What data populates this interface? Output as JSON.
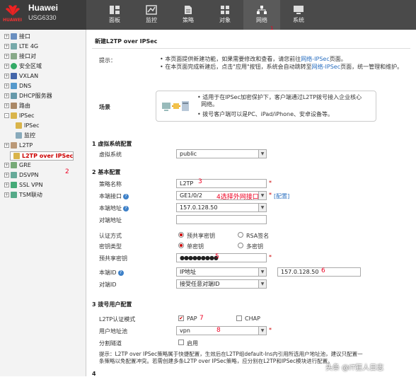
{
  "app": {
    "brand": "HUAWEI",
    "title": "Huawei",
    "model": "USG6330"
  },
  "nav": [
    {
      "label": "面板",
      "icon": "dashboard-icon"
    },
    {
      "label": "监控",
      "icon": "monitor-icon"
    },
    {
      "label": "策略",
      "icon": "policy-icon"
    },
    {
      "label": "对象",
      "icon": "object-icon"
    },
    {
      "label": "网络",
      "icon": "network-icon"
    },
    {
      "label": "系统",
      "icon": "system-icon"
    }
  ],
  "sidebar": {
    "items": [
      {
        "label": "接口",
        "icon": "interface-icon"
      },
      {
        "label": "LTE 4G",
        "icon": "lte-icon"
      },
      {
        "label": "接口对",
        "icon": "interface-pair-icon"
      },
      {
        "label": "安全区域",
        "icon": "security-zone-icon"
      },
      {
        "label": "VXLAN",
        "icon": "vxlan-icon"
      },
      {
        "label": "DNS",
        "icon": "dns-icon"
      },
      {
        "label": "DHCP服务器",
        "icon": "dhcp-icon"
      },
      {
        "label": "路由",
        "icon": "route-icon"
      },
      {
        "label": "IPSec",
        "icon": "ipsec-icon"
      },
      {
        "label": "IPSec",
        "icon": "ipsec-sub-icon"
      },
      {
        "label": "监控",
        "icon": "ipsec-monitor-icon"
      },
      {
        "label": "L2TP",
        "icon": "l2tp-icon"
      },
      {
        "label": "L2TP over IPSec",
        "icon": "l2tp-ipsec-icon"
      },
      {
        "label": "GRE",
        "icon": "gre-icon"
      },
      {
        "label": "DSVPN",
        "icon": "dsvpn-icon"
      },
      {
        "label": "SSL VPN",
        "icon": "sslvpn-icon"
      },
      {
        "label": "TSM联动",
        "icon": "tsm-icon"
      }
    ]
  },
  "annotations": {
    "a1": "1",
    "a2": "2",
    "a3": "3",
    "a4": "4选择外网接口",
    "a5": "5",
    "a6": "6",
    "a7": "7",
    "a8": "8"
  },
  "page": {
    "title": "新建L2TP over IPSec",
    "tip_label": "提示：",
    "tip_line1_pre": "本页面提供新建功能，如果需要修改和查看，请您前往",
    "tip_link1": "网络-IPSec",
    "tip_line1_post": "页面。",
    "tip_line2_pre": "在本页面完成新建后，点击\"应用\"按钮，系统会自动跳转至",
    "tip_link2": "网络-IPSec",
    "tip_line2_post": "页面，统一管理和维护。",
    "scene_label": "场景",
    "scene_line1": "适用于在IPSec加密保护下，客户端通过L2TP拨号接入企业核心",
    "scene_line1b": "网络。",
    "scene_line2": "拨号客户端可以是PC、iPad/iPhone、安卓设备等。",
    "sec1": "1 虚拟系统配置",
    "vsys_label": "虚拟系统",
    "vsys_value": "public",
    "sec2": "2 基本配置",
    "policy_name_label": "策略名称",
    "policy_name_value": "L2TP",
    "local_if_label": "本端接口",
    "local_if_value": "GE1/0/2",
    "config_link": "[配置]",
    "local_addr_label": "本端地址",
    "local_addr_value": "157.0.128.50",
    "peer_addr_label": "对端地址",
    "peer_addr_value": "",
    "auth_label": "认证方式",
    "auth_opt1": "预共享密钥",
    "auth_opt2": "RSA签名",
    "key_type_label": "密钥类型",
    "key_opt1": "单密钥",
    "key_opt2": "多密钥",
    "psk_label": "预共享密钥",
    "psk_value": "●●●●●●●●●",
    "local_id_label": "本端ID",
    "local_id_value": "IP地址",
    "local_id_ip": "157.0.128.50",
    "peer_id_label": "对端ID",
    "peer_id_value": "接受任意对端ID",
    "sec3": "3 拨号用户配置",
    "l2tp_auth_label": "L2TP认证模式",
    "pap": "PAP",
    "chap": "CHAP",
    "pool_label": "用户地址池",
    "pool_value": "vpn",
    "split_label": "分割隧道",
    "split_opt": "启用",
    "bottom_tip_line1": "提示：L2TP over IPSec策略属于快捷配置，生效后在L2TP组default-lns内引用所选用户地址池，建议只配置一",
    "bottom_tip_line2": "条策略以免配置冲突。若需创建多条L2TP over IPSec策略，应分别在L2TP和IPSec模块进行配置。",
    "star": "*",
    "sec4": "4"
  },
  "watermark": "头条 @IT狂人日志"
}
